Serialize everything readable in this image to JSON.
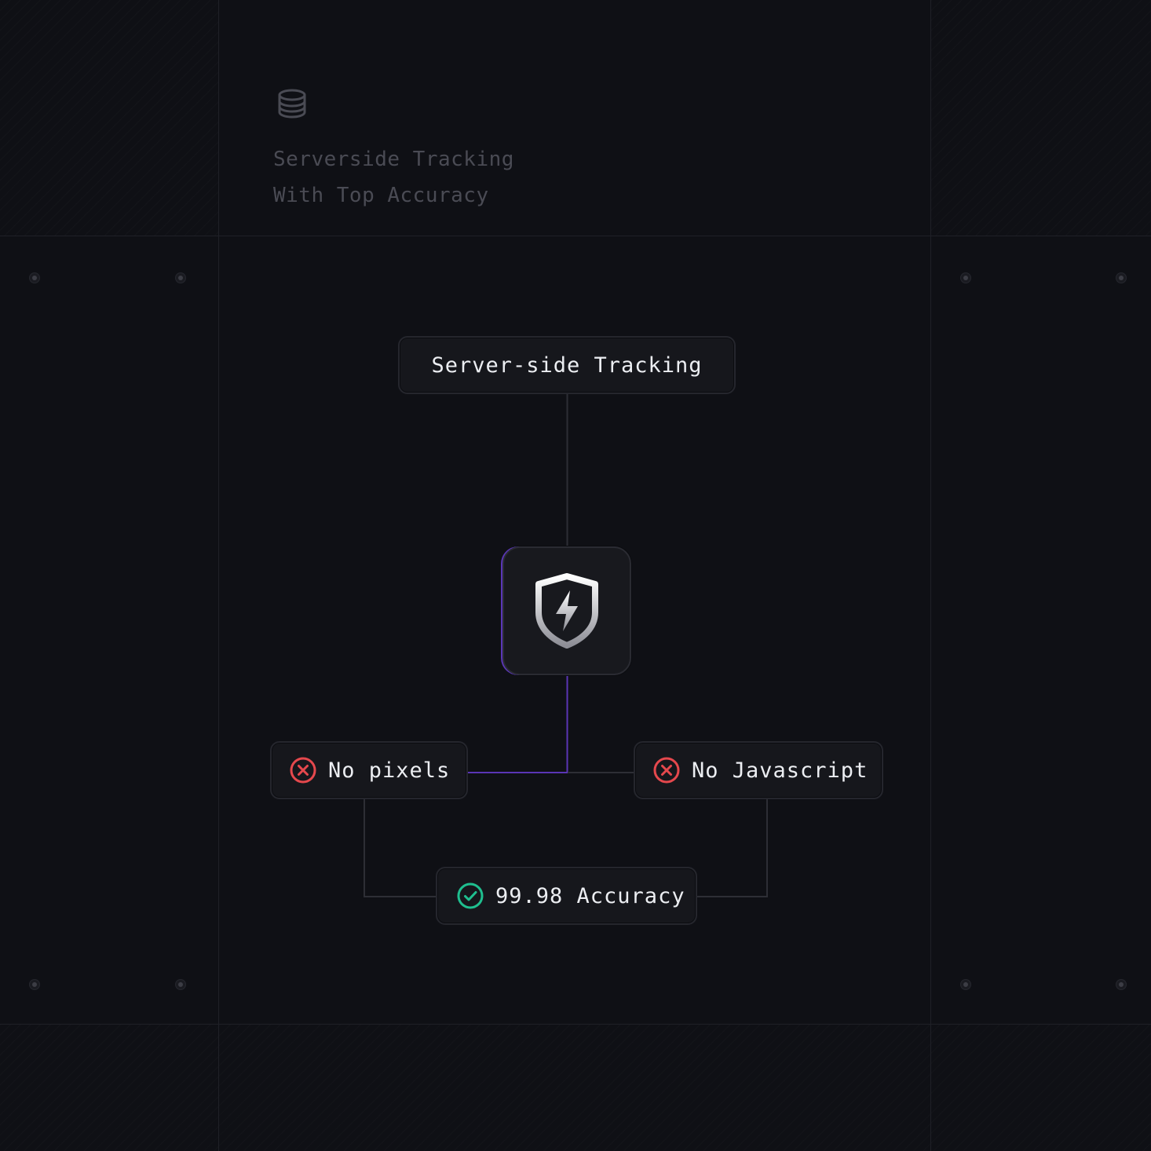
{
  "header": {
    "icon": "database-icon",
    "line1": "Serverside Tracking",
    "line2": "With Top Accuracy"
  },
  "diagram": {
    "top_node": {
      "label": "Server-side Tracking"
    },
    "center_node": {
      "icon": "shield-bolt-icon"
    },
    "left_node": {
      "label": "No pixels",
      "icon": "x-circle-icon",
      "status": "negative"
    },
    "right_node": {
      "label": "No Javascript",
      "icon": "x-circle-icon",
      "status": "negative"
    },
    "bottom_node": {
      "label": "99.98 Accuracy",
      "icon": "check-circle-icon",
      "status": "positive"
    },
    "colors": {
      "background": "#0f1015",
      "accent": "#6d3fe0",
      "negative": "#e5484d",
      "positive": "#1fbf8f"
    }
  }
}
